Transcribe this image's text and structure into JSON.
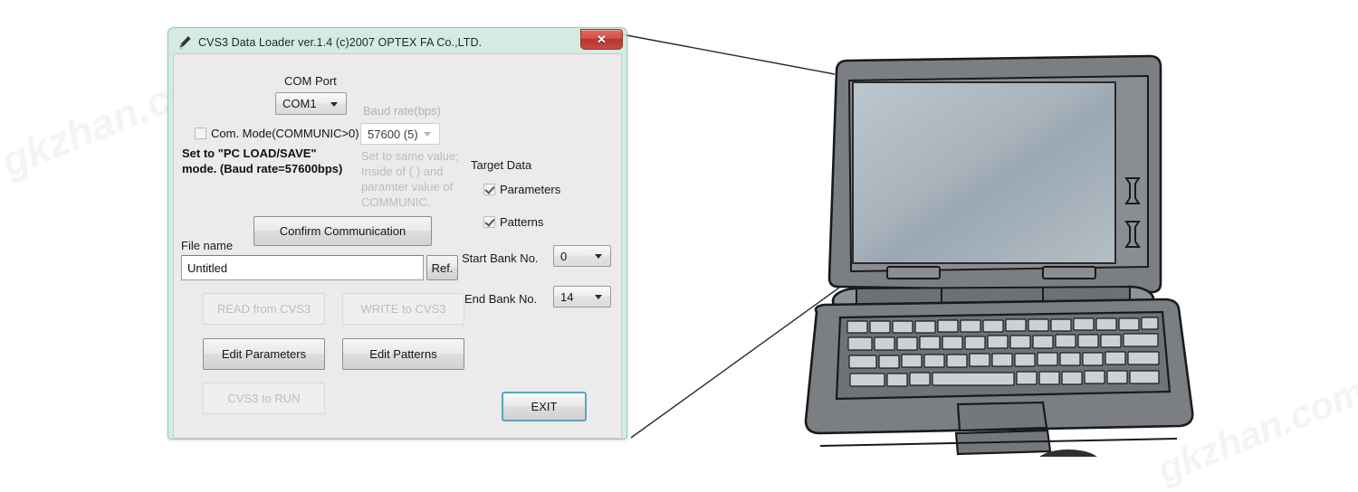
{
  "page": {
    "watermark": "gkzhan.com"
  },
  "dialog": {
    "title": "CVS3 Data Loader ver.1.4 (c)2007 OPTEX FA Co.,LTD.",
    "title_icon": "pen-icon",
    "close_label": "✕",
    "com_port": {
      "label": "COM Port",
      "value": "COM1"
    },
    "baud_rate": {
      "label": "Baud rate(bps)",
      "value": "57600 (5)",
      "enabled": false,
      "help": "Set to same value;\nInside of ( ) and\nparamter value of\nCOMMUNIC."
    },
    "com_mode": {
      "label": "Com. Mode(COMMUNIC>0)",
      "checked": false,
      "help": "Set to \"PC LOAD/SAVE\"\nmode. (Baud rate=57600bps)"
    },
    "confirm_button": "Confirm Communication",
    "file_name": {
      "label": "File name",
      "value": "Untitled",
      "placeholder": "Untitled",
      "ref_button": "Ref."
    },
    "target_data": {
      "label": "Target Data",
      "parameters": {
        "label": "Parameters",
        "checked": true
      },
      "patterns": {
        "label": "Patterns",
        "checked": true
      },
      "start_bank": {
        "label": "Start Bank No.",
        "value": "0"
      },
      "end_bank": {
        "label": "End Bank No.",
        "value": "14"
      }
    },
    "buttons": {
      "read": {
        "label": "READ from CVS3",
        "enabled": false
      },
      "write": {
        "label": "WRITE to CVS3",
        "enabled": false
      },
      "edit_parameters": {
        "label": "Edit Parameters",
        "enabled": true
      },
      "edit_patterns": {
        "label": "Edit Patterns",
        "enabled": true
      },
      "cvs3_to_run": {
        "label": "CVS3 to RUN",
        "enabled": false
      },
      "exit": {
        "label": "EXIT",
        "enabled": true,
        "focused": true
      }
    }
  },
  "illustration": {
    "name": "laptop-computer",
    "colors": {
      "body": "#7b7f84",
      "screen": "#a8b3bd",
      "outline": "#1a1a1a",
      "key": "#d5d8db"
    }
  },
  "colors": {
    "dialog_frame": "#cde8dc",
    "client_bg": "#eceaea",
    "close_red": "#c74a45",
    "focus_blue": "#5ba3bf",
    "disabled_text": "#bdbdbd"
  }
}
